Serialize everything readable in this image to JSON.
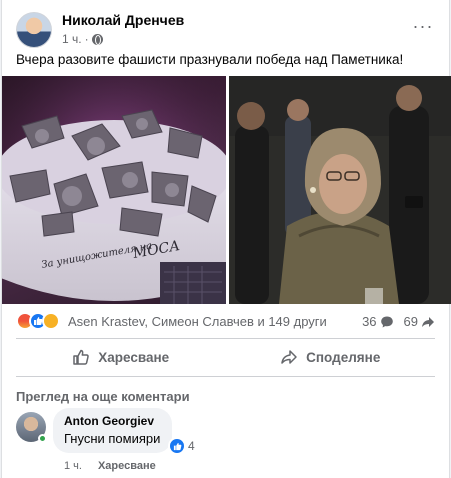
{
  "post": {
    "author": "Николай Дренчев",
    "time": "1 ч.",
    "separator": "·",
    "more_label": "···",
    "text": "Вчера разовите фашисти празнували победа над Паметника!"
  },
  "photos": {
    "cake_inscription_line1": "За унищожителя на",
    "cake_inscription_line2": "МОСА"
  },
  "reactions": {
    "icons": [
      "angry-icon",
      "like-icon",
      "sad-icon"
    ],
    "names": "Asen Krastev, Симеон Славчев и 149 други",
    "comments_count": "36",
    "shares_count": "69"
  },
  "actions": {
    "like_label": "Харесване",
    "share_label": "Споделяне"
  },
  "comments": {
    "more_label": "Преглед на още коментари",
    "items": [
      {
        "author": "Anton Georgiev",
        "text": "Гнусни помияри",
        "reaction_count": "4",
        "time": "1 ч.",
        "like_label": "Харесване"
      }
    ]
  },
  "colors": {
    "like_blue": "#1877f2",
    "secondary_text": "#65676b",
    "online_green": "#31a24c"
  }
}
